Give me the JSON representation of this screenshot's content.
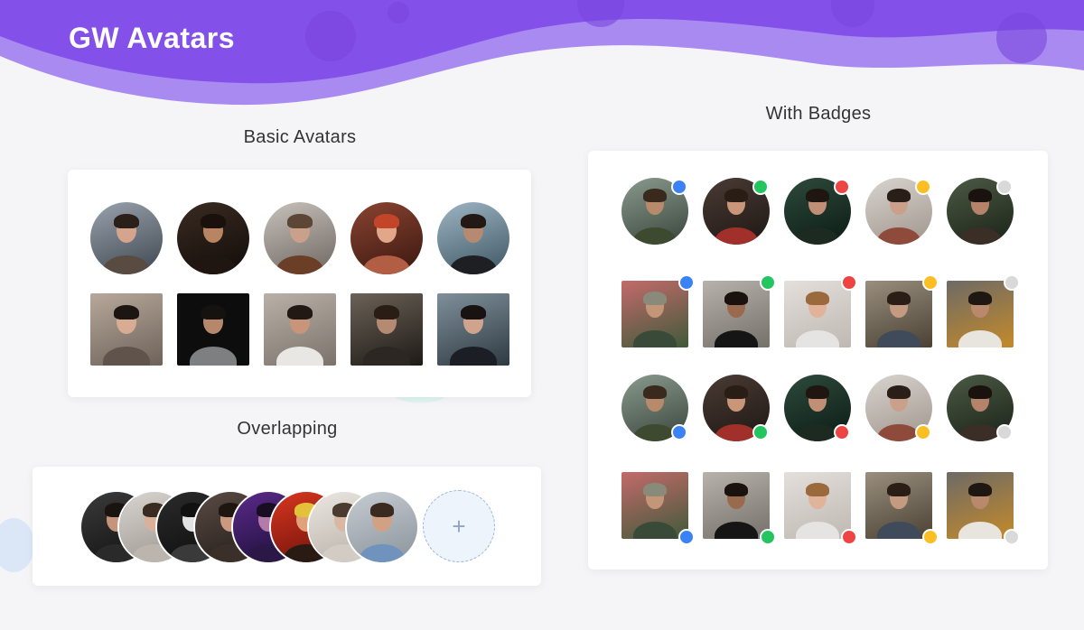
{
  "header": {
    "title": "GW Avatars",
    "colors": {
      "wave_dark": "#7f4ee8",
      "wave_light": "#a784f1",
      "text": "#ffffff"
    }
  },
  "sections": {
    "basic": {
      "title": "Basic Avatars"
    },
    "badges": {
      "title": "With Badges"
    },
    "overlapping": {
      "title": "Overlapping"
    }
  },
  "overlapping": {
    "add_button": {
      "icon": "plus-icon",
      "glyph": "+"
    }
  },
  "badge_colors": {
    "blue": "#3b82f6",
    "green": "#22c55e",
    "red": "#ef4444",
    "yellow": "#fbbf24",
    "gray": "#d9d9d9"
  }
}
